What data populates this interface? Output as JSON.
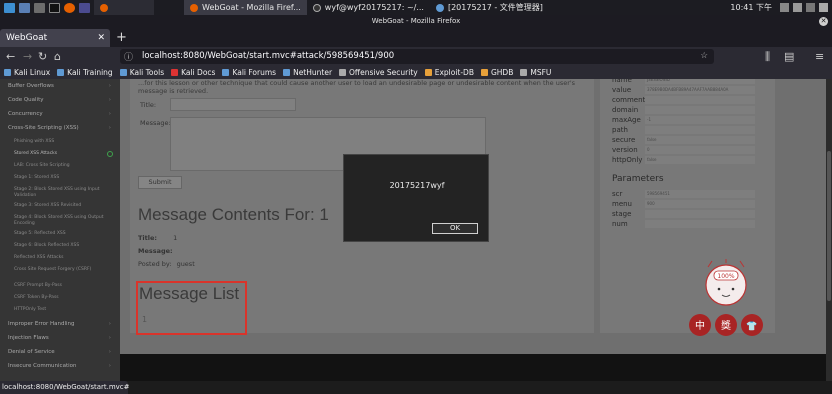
{
  "taskbar": {
    "tasks": [
      {
        "label": "WebGoat - Mozilla Firef..."
      },
      {
        "label": "wyf@wyf20175217: ~/..."
      },
      {
        "label": "[20175217 - 文件管理器]"
      }
    ],
    "clock": "10:41 下午"
  },
  "window": {
    "title": "WebGoat - Mozilla Firefox"
  },
  "tabs": [
    {
      "label": "WebGoat"
    }
  ],
  "urlbar": {
    "url": "localhost:8080/WebGoat/start.mvc#attack/598569451/900"
  },
  "bookmarks": [
    {
      "label": "Kali Linux",
      "color": "#5f9ad4"
    },
    {
      "label": "Kali Training",
      "color": "#5f9ad4"
    },
    {
      "label": "Kali Tools",
      "color": "#5f9ad4"
    },
    {
      "label": "Kali Docs",
      "color": "#d33"
    },
    {
      "label": "Kali Forums",
      "color": "#5f9ad4"
    },
    {
      "label": "NetHunter",
      "color": "#5f9ad4"
    },
    {
      "label": "Offensive Security",
      "color": "#aaa"
    },
    {
      "label": "Exploit-DB",
      "color": "#e8a13a"
    },
    {
      "label": "GHDB",
      "color": "#e8a13a"
    },
    {
      "label": "MSFU",
      "color": "#aaa"
    }
  ],
  "sidebar": {
    "top_items": [
      {
        "label": "Buffer Overflows"
      },
      {
        "label": "Code Quality"
      },
      {
        "label": "Concurrency"
      },
      {
        "label": "Cross-Site Scripting (XSS)"
      }
    ],
    "sub_items": [
      {
        "label": "Phishing with XSS"
      },
      {
        "label": "Stored XSS Attacks"
      },
      {
        "label": "LAB: Cross Site Scripting"
      },
      {
        "label": "Stage 1: Stored XSS"
      },
      {
        "label": "Stage 2: Block Stored XSS using Input Validation"
      },
      {
        "label": "Stage 3: Stored XSS Revisited"
      },
      {
        "label": "Stage 4: Block Stored XSS using Output Encoding"
      },
      {
        "label": "Stage 5: Reflected XSS"
      },
      {
        "label": "Stage 6: Block Reflected XSS"
      },
      {
        "label": "Reflected XSS Attacks"
      },
      {
        "label": "Cross Site Request Forgery (CSRF)"
      },
      {
        "label": "CSRF Prompt By-Pass"
      },
      {
        "label": "CSRF Token By-Pass"
      },
      {
        "label": "HTTPOnly Test"
      }
    ],
    "bottom_items": [
      {
        "label": "Improper Error Handling"
      },
      {
        "label": "Injection Flaws"
      },
      {
        "label": "Denial of Service"
      },
      {
        "label": "Insecure Communication"
      }
    ]
  },
  "lesson": {
    "intro_text": "...for this lesson or other technique that could cause another user to load an undesirable page or undesirable content when the user's message is retrieved.",
    "title_label": "Title:",
    "message_label": "Message:",
    "submit_label": "Submit",
    "contents_heading": "Message Contents For: 1",
    "meta_title_label": "Title:",
    "meta_title_value": "1",
    "meta_message_label": "Message:",
    "meta_posted_label": "Posted by:",
    "meta_posted_value": "guest",
    "list_heading": "Message List",
    "list_items": [
      "1"
    ]
  },
  "cookies": [
    {
      "key": "name",
      "value": "JSESSIONID"
    },
    {
      "key": "value",
      "value": "378E9B0DA4BFB89A47AAF7AAB884A0A"
    },
    {
      "key": "comment",
      "value": ""
    },
    {
      "key": "domain",
      "value": ""
    },
    {
      "key": "maxAge",
      "value": "-1"
    },
    {
      "key": "path",
      "value": ""
    },
    {
      "key": "secure",
      "value": "false"
    },
    {
      "key": "version",
      "value": "0"
    },
    {
      "key": "httpOnly",
      "value": "false"
    }
  ],
  "parameters": {
    "title": "Parameters",
    "rows": [
      {
        "key": "scr",
        "value": "598569451"
      },
      {
        "key": "menu",
        "value": "900"
      },
      {
        "key": "stage",
        "value": ""
      },
      {
        "key": "num",
        "value": ""
      }
    ]
  },
  "dialog": {
    "message": "20175217wyf",
    "ok_label": "OK"
  },
  "mascot": {
    "badge": "100%",
    "chars": [
      "中",
      "獎",
      "👕"
    ]
  },
  "status": {
    "text": "localhost:8080/WebGoat/start.mvc#"
  }
}
